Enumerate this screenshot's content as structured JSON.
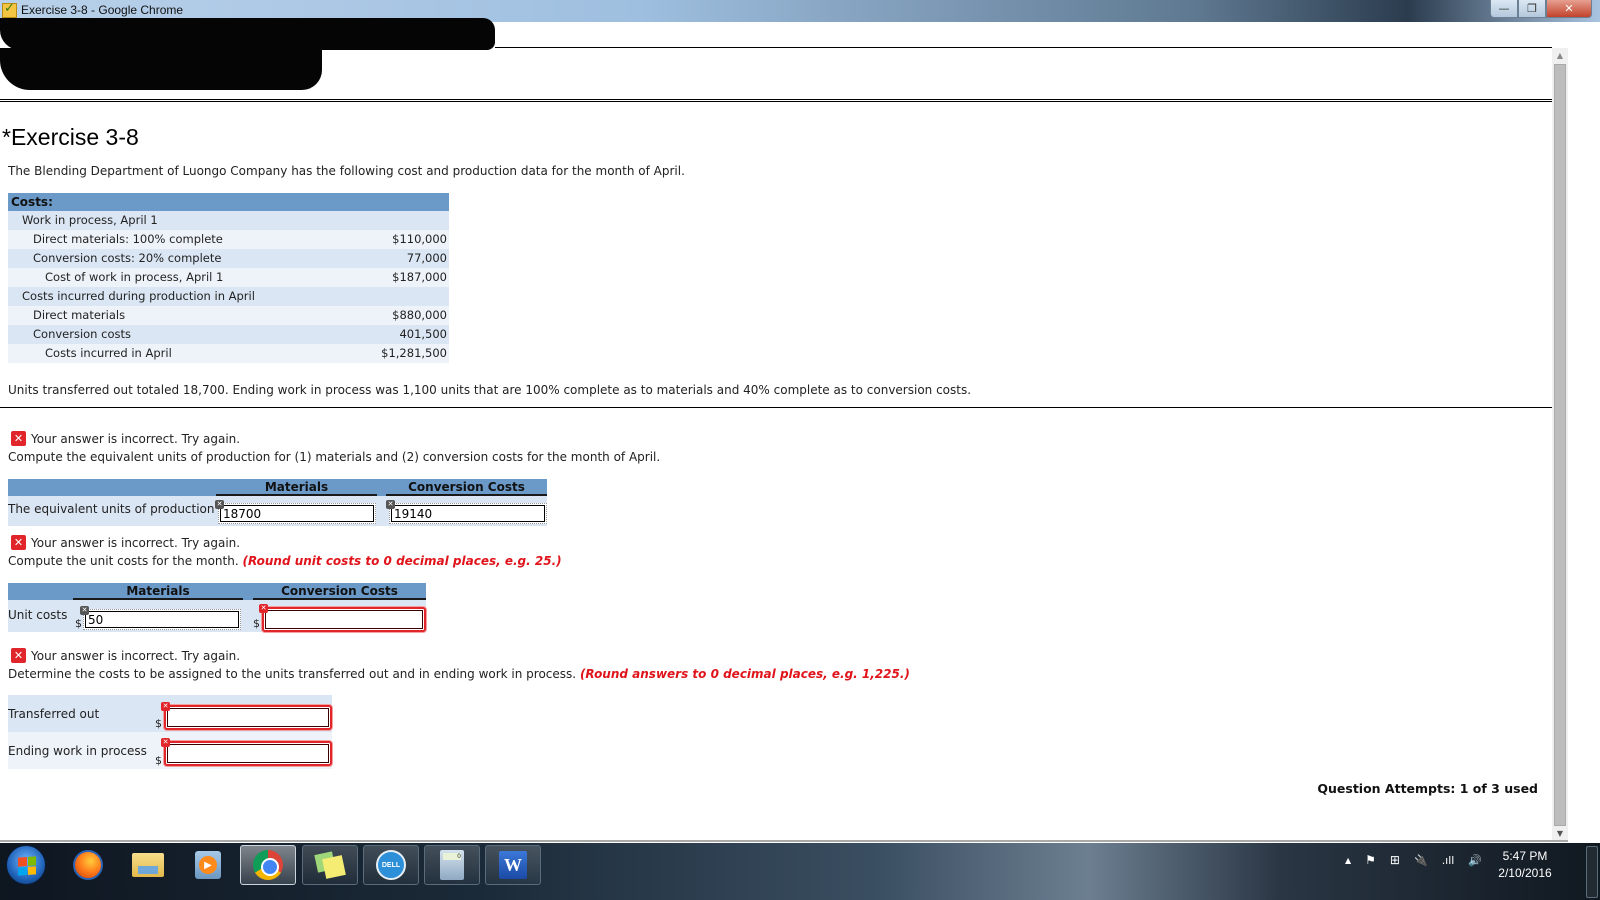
{
  "window": {
    "title": "Exercise 3-8 - Google Chrome",
    "controls": {
      "minimize": "—",
      "restore": "❐",
      "close": "✕"
    }
  },
  "page": {
    "exercise_title": "*Exercise 3-8",
    "intro": "The Blending Department of Luongo Company has the following cost and production data for the month of April.",
    "costs_table": {
      "header": "Costs:",
      "rows": [
        {
          "label": "Work in process, April 1",
          "value": ""
        },
        {
          "label": "Direct materials: 100% complete",
          "value": "$110,000"
        },
        {
          "label": "Conversion costs: 20% complete",
          "value": "77,000"
        },
        {
          "label": "Cost of work in process, April 1",
          "value": "$187,000"
        },
        {
          "label": "Costs incurred during production in April",
          "value": ""
        },
        {
          "label": "Direct materials",
          "value": "$880,000"
        },
        {
          "label": "Conversion costs",
          "value": "401,500"
        },
        {
          "label": "Costs incurred in April",
          "value": "$1,281,500"
        }
      ]
    },
    "units_text": "Units transferred out totaled 18,700. Ending work in process was 1,100 units that are 100% complete as to materials and 40% complete as to conversion costs.",
    "error_message": "Your answer is incorrect.  Try again.",
    "part1": {
      "instruction": "Compute the equivalent units of production for (1) materials and (2) conversion costs for the month of April.",
      "col_materials": "Materials",
      "col_conversion": "Conversion Costs",
      "row_label": "The equivalent units of production",
      "materials_value": "18700",
      "conversion_value": "19140"
    },
    "part2": {
      "instruction": "Compute the unit costs for the month.",
      "hint": "(Round unit costs to 0 decimal places, e.g. 25.)",
      "col_materials": "Materials",
      "col_conversion": "Conversion Costs",
      "row_label": "Unit costs",
      "currency": "$",
      "materials_value": "50",
      "conversion_value": ""
    },
    "part3": {
      "instruction": "Determine the costs to be assigned to the units transferred out and in ending work in process.",
      "hint": "(Round answers to 0 decimal places, e.g. 1,225.)",
      "currency": "$",
      "rows": [
        {
          "label": "Transferred out",
          "value": ""
        },
        {
          "label": "Ending work in process",
          "value": ""
        }
      ]
    },
    "attempts": "Question Attempts: 1 of 3 used"
  },
  "icons": {
    "error_mark": "✕",
    "field_mark": "✕",
    "scroll_up": "▲",
    "scroll_down": "▼"
  },
  "taskbar": {
    "items": [
      "Start",
      "Firefox",
      "Windows Explorer",
      "Windows Media Player",
      "Google Chrome",
      "Sticky Notes",
      "Dell",
      "Calculator",
      "Microsoft Word"
    ],
    "dell_label": "DELL",
    "word_label": "W",
    "tray": {
      "expand": "▲",
      "flag": "⚑",
      "windows": "⊞",
      "power": "🔌",
      "signal": ".ıll",
      "volume": "🔊"
    },
    "clock_time": "5:47 PM",
    "clock_date": "2/10/2016"
  },
  "colors": {
    "table_header": "#6b9ac8",
    "row_light": "#eef3fa",
    "row_dark": "#dbe6f4",
    "error_red": "#e0262b",
    "hint_red": "#e0141b"
  }
}
